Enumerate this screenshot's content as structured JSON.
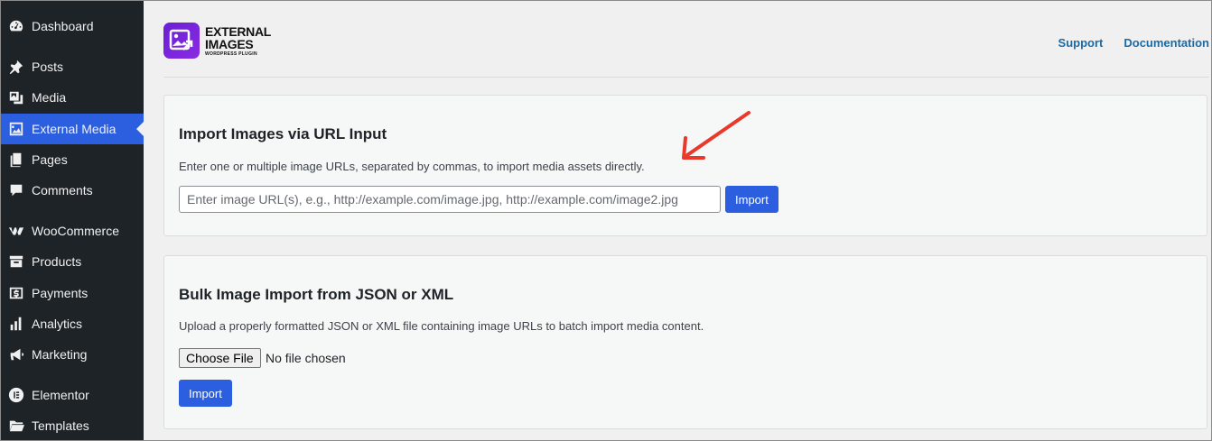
{
  "sidebar": {
    "items": [
      {
        "label": "Dashboard",
        "icon": "dashboard-icon"
      },
      {
        "label": "Posts",
        "icon": "pin-icon"
      },
      {
        "label": "Media",
        "icon": "media-icon"
      },
      {
        "label": "External Media",
        "icon": "external-media-icon",
        "active": true
      },
      {
        "label": "Pages",
        "icon": "pages-icon"
      },
      {
        "label": "Comments",
        "icon": "comments-icon"
      },
      {
        "label": "WooCommerce",
        "icon": "woocommerce-icon"
      },
      {
        "label": "Products",
        "icon": "products-icon"
      },
      {
        "label": "Payments",
        "icon": "payments-icon"
      },
      {
        "label": "Analytics",
        "icon": "analytics-icon"
      },
      {
        "label": "Marketing",
        "icon": "megaphone-icon"
      },
      {
        "label": "Elementor",
        "icon": "elementor-icon"
      },
      {
        "label": "Templates",
        "icon": "folder-icon"
      }
    ]
  },
  "header": {
    "logo_title_line1": "EXTERNAL",
    "logo_title_line2": "IMAGES",
    "logo_subtitle": "WORDPRESS PLUGIN",
    "support_label": "Support",
    "documentation_label": "Documentation"
  },
  "url_import": {
    "title": "Import Images via URL Input",
    "description": "Enter one or multiple image URLs, separated by commas, to import media assets directly.",
    "placeholder": "Enter image URL(s), e.g., http://example.com/image.jpg, http://example.com/image2.jpg",
    "button_label": "Import"
  },
  "bulk_import": {
    "title": "Bulk Image Import from JSON or XML",
    "description": "Upload a properly formatted JSON or XML file containing image URLs to batch import media content.",
    "choose_file_label": "Choose File",
    "file_status": "No file chosen",
    "button_label": "Import"
  },
  "colors": {
    "sidebar_bg": "#1d2327",
    "active_item": "#2c5fe0",
    "primary_button": "#2c5fe0",
    "link": "#1a6aa6",
    "annotation_arrow": "#e8392b",
    "logo": "#7b22dc"
  }
}
